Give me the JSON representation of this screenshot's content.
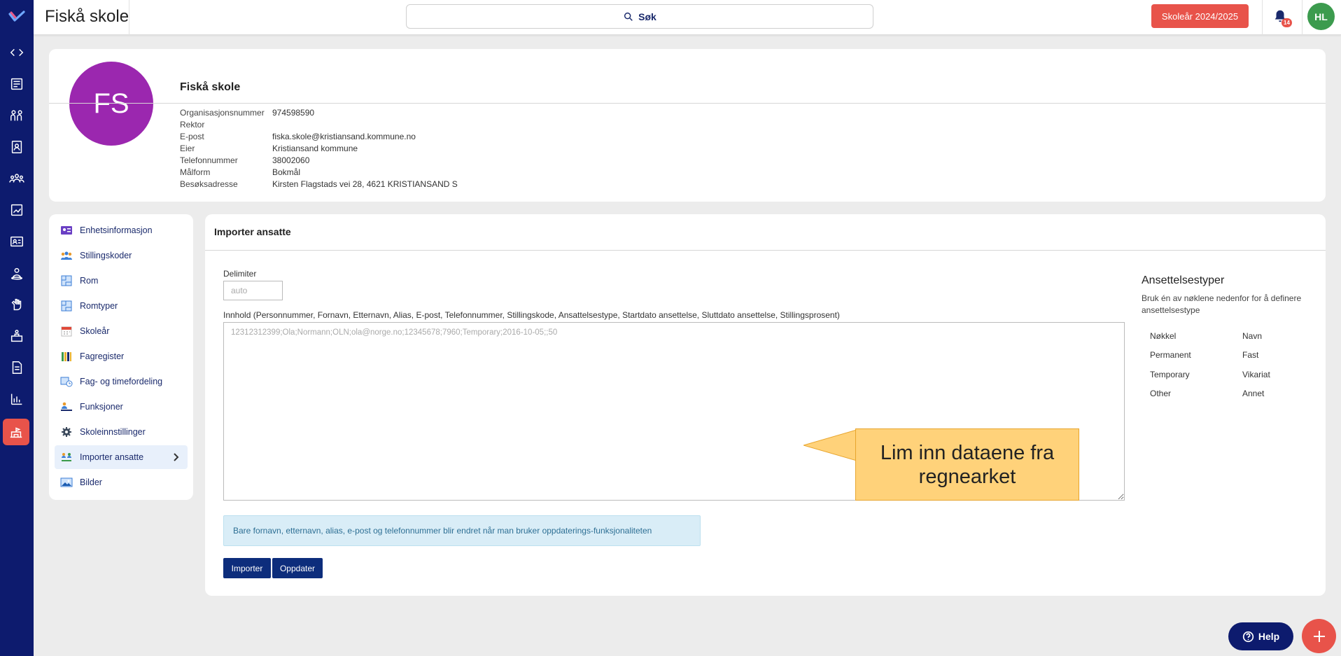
{
  "app": {
    "school_name": "Fiskå skole",
    "search_label": "Søk",
    "school_year_button": "Skoleår 2024/2025",
    "notification_count": "14",
    "user_initials": "HL"
  },
  "profile": {
    "initials": "FS",
    "name": "Fiskå skole",
    "fields": [
      {
        "label": "Organisasjonsnummer",
        "value": "974598590"
      },
      {
        "label": "Rektor",
        "value": ""
      },
      {
        "label": "E-post",
        "value": "fiska.skole@kristiansand.kommune.no"
      },
      {
        "label": "Eier",
        "value": "Kristiansand kommune"
      },
      {
        "label": "Telefonnummer",
        "value": "38002060"
      },
      {
        "label": "Målform",
        "value": "Bokmål"
      },
      {
        "label": "Besøksadresse",
        "value": "Kirsten Flagstads vei 28, 4621 KRISTIANSAND S"
      }
    ]
  },
  "menu": {
    "items": [
      {
        "label": "Enhetsinformasjon",
        "icon": "id-card-icon"
      },
      {
        "label": "Stillingskoder",
        "icon": "people-icon"
      },
      {
        "label": "Rom",
        "icon": "floorplan-icon"
      },
      {
        "label": "Romtyper",
        "icon": "floorplan-icon"
      },
      {
        "label": "Skoleår",
        "icon": "calendar-icon"
      },
      {
        "label": "Fagregister",
        "icon": "books-icon"
      },
      {
        "label": "Fag- og timefordeling",
        "icon": "schedule-icon"
      },
      {
        "label": "Funksjoner",
        "icon": "person-desk-icon"
      },
      {
        "label": "Skoleinnstillinger",
        "icon": "gear-icon"
      },
      {
        "label": "Importer ansatte",
        "icon": "import-people-icon",
        "active": true
      },
      {
        "label": "Bilder",
        "icon": "image-icon"
      }
    ]
  },
  "import": {
    "title": "Importer ansatte",
    "delimiter_label": "Delimiter",
    "delimiter_placeholder": "auto",
    "content_label": "Innhold (Personnummer, Fornavn, Etternavn, Alias, E-post, Telefonnummer, Stillingskode, Ansattelsestype, Startdato ansettelse, Sluttdato ansettelse, Stillingsprosent)",
    "content_placeholder": "12312312399;Ola;Normann;OLN;ola@norge.no;12345678;7960;Temporary;2016-10-05;;50",
    "notice": "Bare fornavn, etternavn, alias, e-post og telefonnummer blir endret når man bruker oppdaterings-funksjonaliteten",
    "import_button": "Importer",
    "update_button": "Oppdater"
  },
  "employment_types": {
    "title": "Ansettelsestyper",
    "description": "Bruk én av nøklene nedenfor for å definere ansettelsestype",
    "header_key": "Nøkkel",
    "header_name": "Navn",
    "rows": [
      {
        "key": "Permanent",
        "name": "Fast"
      },
      {
        "key": "Temporary",
        "name": "Vikariat"
      },
      {
        "key": "Other",
        "name": "Annet"
      }
    ]
  },
  "callout": {
    "text": "Lim inn dataene fra regnearket"
  },
  "help_button": "Help",
  "colors": {
    "rail": "#0d1b6e",
    "accent": "#e8534a",
    "primary_button": "#0d2d7c",
    "profile_avatar": "#9b27af",
    "user_avatar": "#3c9b4e",
    "callout": "#ffd27a"
  }
}
